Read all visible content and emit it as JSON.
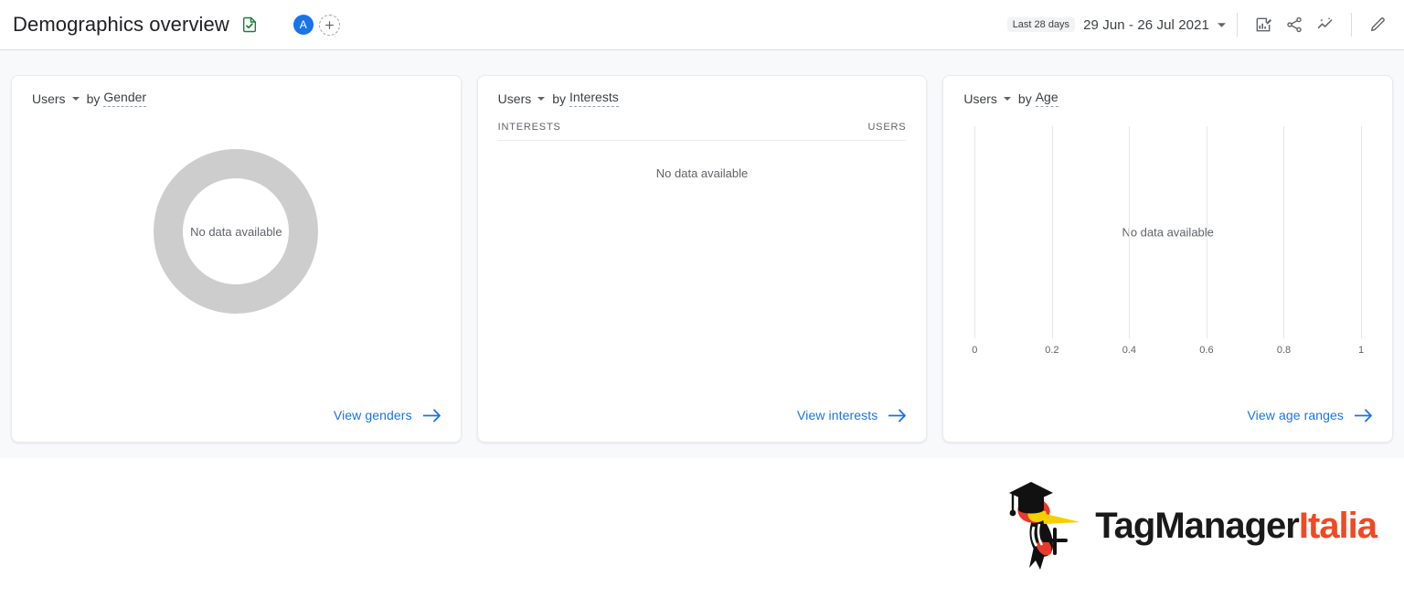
{
  "header": {
    "title": "Demographics overview",
    "doc_icon": "document-check-icon",
    "avatar_initial": "A",
    "add_collaborator_icon": "plus-icon",
    "date_chip": "Last 28 days",
    "date_range": "29 Jun - 26 Jul 2021",
    "icons": [
      {
        "name": "customize-report-icon",
        "label": "Customize report"
      },
      {
        "name": "share-icon",
        "label": "Share"
      },
      {
        "name": "insights-icon",
        "label": "Insights"
      },
      {
        "name": "edit-pencil-icon",
        "label": "Edit"
      }
    ]
  },
  "cards": [
    {
      "metric": "Users",
      "by": "by",
      "dimension": "Gender",
      "empty_text": "No data available",
      "link": "View genders"
    },
    {
      "metric": "Users",
      "by": "by",
      "dimension": "Interests",
      "col_dimension": "INTERESTS",
      "col_metric": "USERS",
      "empty_text": "No data available",
      "link": "View interests"
    },
    {
      "metric": "Users",
      "by": "by",
      "dimension": "Age",
      "empty_text": "No data available",
      "link": "View age ranges"
    }
  ],
  "chart_data": {
    "type": "bar",
    "title": "Users by Age",
    "categories": [],
    "values": [],
    "series": [
      {
        "name": "Users",
        "values": []
      }
    ],
    "xlabel": "",
    "ylabel": "",
    "xlim": [
      0,
      1
    ],
    "xticks": [
      "0",
      "0.2",
      "0.4",
      "0.6",
      "0.8",
      "1"
    ],
    "grid": true,
    "legend": "none",
    "empty_state": "No data available"
  },
  "logo": {
    "primary": "TagManager",
    "accent": "Italia"
  },
  "colors": {
    "accent_blue": "#1a73e8",
    "logo_red": "#f04923",
    "donut_gray": "#cdcdcd",
    "page_bg": "#f8f9fa"
  }
}
